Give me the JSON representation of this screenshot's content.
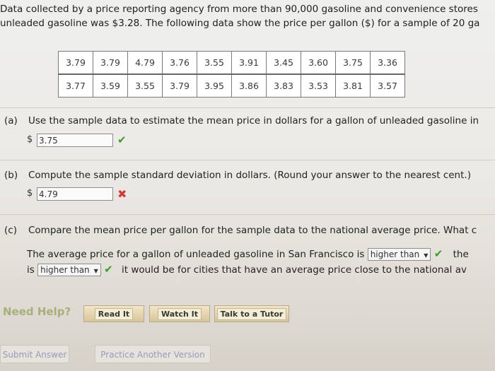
{
  "intro": {
    "line1": "Data collected by a price reporting agency from more than 90,000 gasoline and convenience stores",
    "line2": "unleaded gasoline was $3.28. The following data show the price per gallon ($) for a sample of 20 ga"
  },
  "table": {
    "rows": [
      [
        "3.79",
        "3.79",
        "4.79",
        "3.76",
        "3.55",
        "3.91",
        "3.45",
        "3.60",
        "3.75",
        "3.36"
      ],
      [
        "3.77",
        "3.59",
        "3.55",
        "3.79",
        "3.95",
        "3.86",
        "3.83",
        "3.53",
        "3.81",
        "3.57"
      ]
    ]
  },
  "part_a": {
    "label": "(a)",
    "question": "Use the sample data to estimate the mean price in dollars for a gallon of unleaded gasoline in",
    "dollar": "$",
    "answer": "3.75",
    "status_icon": "checkmark-icon"
  },
  "part_b": {
    "label": "(b)",
    "question": "Compute the sample standard deviation in dollars. (Round your answer to the nearest cent.)",
    "dollar": "$",
    "answer": "4.79",
    "status_icon": "x-icon"
  },
  "part_c": {
    "label": "(c)",
    "question": "Compare the mean price per gallon for the sample data to the national average price. What c",
    "sentence_start": "The average price for a gallon of unleaded gasoline in San Francisco is",
    "select1": "higher than",
    "sentence_mid": "the",
    "sentence2_start": "is",
    "select2": "higher than",
    "sentence2_end": "it would be for cities that have an average price close to the national av"
  },
  "help": {
    "label": "Need Help?",
    "read": "Read It",
    "watch": "Watch It",
    "tutor": "Talk to a Tutor"
  },
  "footer": {
    "submit": "Submit Answer",
    "practice": "Practice Another Version"
  },
  "colors": {
    "check": "#3c9a2c",
    "cross": "#d23a3a",
    "need_help": "#a8b07a"
  }
}
